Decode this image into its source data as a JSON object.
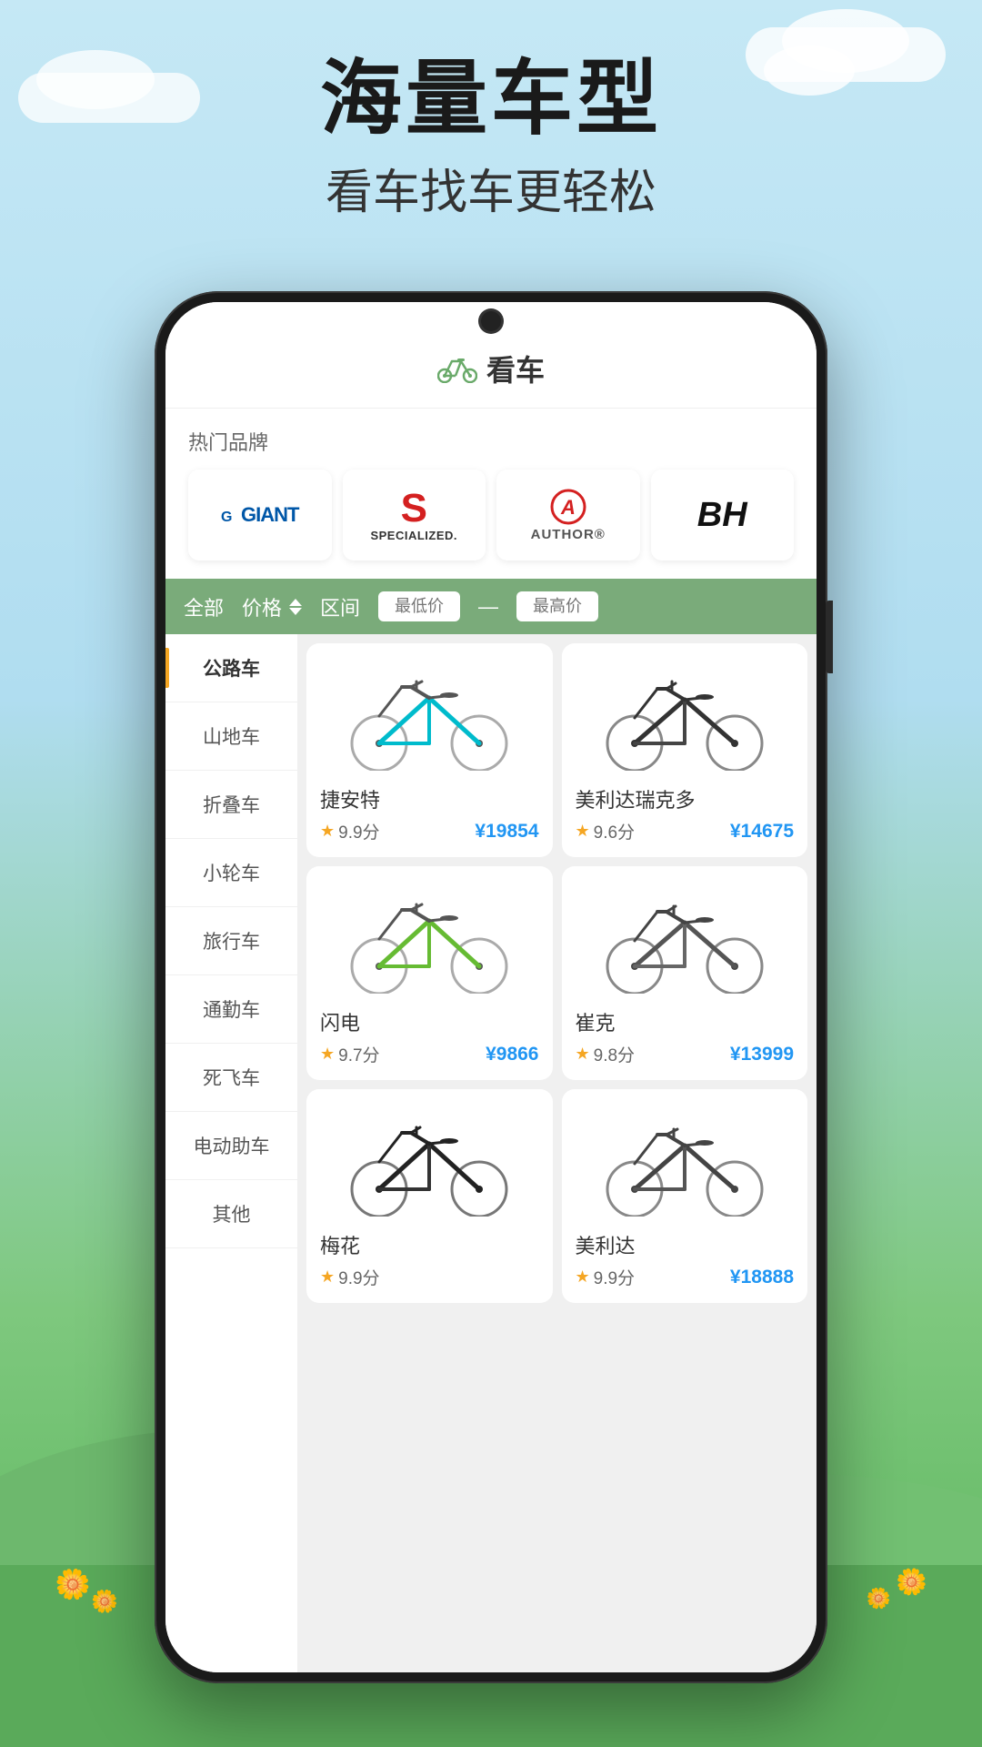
{
  "background": {
    "headline": "海量车型",
    "subheadline": "看车找车更轻松"
  },
  "app": {
    "logo_text": "看车",
    "logo_icon": "🚲"
  },
  "brands": {
    "section_label": "热门品牌",
    "items": [
      {
        "id": "giant",
        "name": "GIANT",
        "type": "giant"
      },
      {
        "id": "specialized",
        "name": "SPECIALIZED",
        "type": "specialized"
      },
      {
        "id": "author",
        "name": "AUTHOR",
        "type": "author"
      },
      {
        "id": "bh",
        "name": "BH",
        "type": "bh"
      }
    ]
  },
  "filter": {
    "all_label": "全部",
    "price_label": "价格",
    "range_label": "区间",
    "min_placeholder": "最低价",
    "max_placeholder": "最高价",
    "dash": "—"
  },
  "categories": [
    {
      "id": "road",
      "label": "公路车",
      "active": true
    },
    {
      "id": "mountain",
      "label": "山地车",
      "active": false
    },
    {
      "id": "folding",
      "label": "折叠车",
      "active": false
    },
    {
      "id": "bmx",
      "label": "小轮车",
      "active": false
    },
    {
      "id": "touring",
      "label": "旅行车",
      "active": false
    },
    {
      "id": "commute",
      "label": "通勤车",
      "active": false
    },
    {
      "id": "fixed",
      "label": "死飞车",
      "active": false
    },
    {
      "id": "electric",
      "label": "电动助车",
      "active": false
    },
    {
      "id": "other",
      "label": "其他",
      "active": false
    }
  ],
  "products": [
    {
      "id": "p1",
      "name": "捷安特",
      "rating": "9.9分",
      "price": "¥19854",
      "color": "#00aacc"
    },
    {
      "id": "p2",
      "name": "美利达瑞克多",
      "rating": "9.6分",
      "price": "¥14675",
      "color": "#333"
    },
    {
      "id": "p3",
      "name": "闪电",
      "rating": "9.7分",
      "price": "¥9866",
      "color": "#66bb33"
    },
    {
      "id": "p4",
      "name": "崔克",
      "rating": "9.8分",
      "price": "¥13999",
      "color": "#555"
    },
    {
      "id": "p5",
      "name": "梅花",
      "rating": "9.9分",
      "price": "",
      "color": "#222"
    },
    {
      "id": "p6",
      "name": "美利达",
      "rating": "9.9分",
      "price": "¥18888",
      "color": "#444"
    }
  ]
}
